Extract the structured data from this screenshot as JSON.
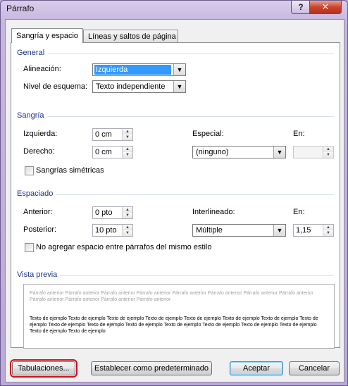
{
  "window": {
    "title": "Párrafo",
    "help": "?",
    "close": "✕"
  },
  "tabs": [
    {
      "label": "Sangría y espacio",
      "active": true
    },
    {
      "label": "Líneas y saltos de página",
      "active": false
    }
  ],
  "general": {
    "heading": "General",
    "alignment_label": "Alineación:",
    "alignment_value": "Izquierda",
    "outline_label": "Nivel de esquema:",
    "outline_value": "Texto independiente"
  },
  "indent": {
    "heading": "Sangría",
    "left_label": "Izquierda:",
    "left_value": "0 cm",
    "right_label": "Derecho:",
    "right_value": "0 cm",
    "special_label": "Especial:",
    "special_value": "(ninguno)",
    "by_label": "En:",
    "by_value": "",
    "mirror_label": "Sangrías simétricas"
  },
  "spacing": {
    "heading": "Espaciado",
    "before_label": "Anterior:",
    "before_value": "0 pto",
    "after_label": "Posterior:",
    "after_value": "10 pto",
    "line_label": "Interlineado:",
    "line_value": "Múltiple",
    "at_label": "En:",
    "at_value": "1,15",
    "no_space_label": "No agregar espacio entre párrafos del mismo estilo"
  },
  "preview": {
    "heading": "Vista previa",
    "before_text": "Párrafo anterior Párrafo anterior Párrafo anterior Párrafo anterior Párrafo anterior Párrafo anterior Párrafo anterior Párrafo anterior Párrafo anterior Párrafo anterior Párrafo anterior Párrafo anterior",
    "sample_text": "Texto de ejemplo Texto de ejemplo Texto de ejemplo Texto de ejemplo Texto de ejemplo Texto de ejemplo Texto de ejemplo Texto de ejemplo Texto de ejemplo Texto de ejemplo Texto de ejemplo Texto de ejemplo Texto de ejemplo Texto de ejemplo Texto de ejemplo Texto de ejemplo Texto de ejemplo"
  },
  "buttons": {
    "tabs": "Tabulaciones...",
    "default": "Establecer como predeterminado",
    "ok": "Aceptar",
    "cancel": "Cancelar"
  }
}
